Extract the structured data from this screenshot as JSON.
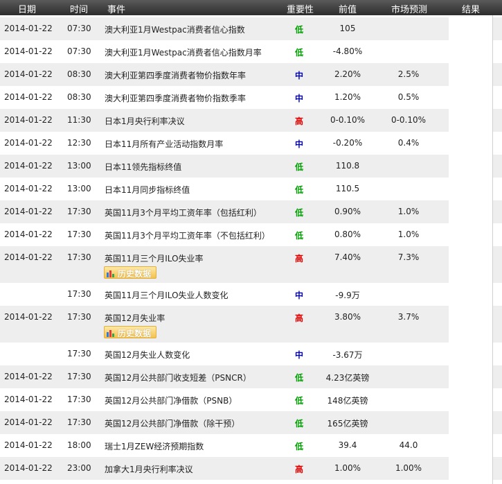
{
  "header": {
    "date": "日期",
    "time": "时间",
    "event": "事件",
    "importance": "重要性",
    "previous": "前值",
    "forecast": "市场预测",
    "result": "结果"
  },
  "history_label": "历史数据",
  "colors": {
    "header_bg": "#3c3c3c",
    "row_shade": "#eeeeee",
    "low": "#00a000",
    "medium": "#0000c0",
    "high": "#e00000",
    "button": "#f3c14f"
  },
  "rows": [
    {
      "date": "2014-01-22",
      "time": "07:30",
      "event": "澳大利亚1月Westpac消费者信心指数",
      "importance": "低",
      "level": "low",
      "previous": "105",
      "forecast": "",
      "result": "",
      "history": false
    },
    {
      "date": "2014-01-22",
      "time": "07:30",
      "event": "澳大利亚1月Westpac消费者信心指数月率",
      "importance": "低",
      "level": "low",
      "previous": "-4.80%",
      "forecast": "",
      "result": "",
      "history": false
    },
    {
      "date": "2014-01-22",
      "time": "08:30",
      "event": "澳大利亚第四季度消费者物价指数年率",
      "importance": "中",
      "level": "mid",
      "previous": "2.20%",
      "forecast": "2.5%",
      "result": "",
      "history": false
    },
    {
      "date": "2014-01-22",
      "time": "08:30",
      "event": "澳大利亚第四季度消费者物价指数季率",
      "importance": "中",
      "level": "mid",
      "previous": "1.20%",
      "forecast": "0.5%",
      "result": "",
      "history": false
    },
    {
      "date": "2014-01-22",
      "time": "11:30",
      "event": "日本1月央行利率决议",
      "importance": "高",
      "level": "high",
      "previous": "0-0.10%",
      "forecast": "0-0.10%",
      "result": "",
      "history": false
    },
    {
      "date": "2014-01-22",
      "time": "12:30",
      "event": "日本11月所有产业活动指数月率",
      "importance": "中",
      "level": "mid",
      "previous": "-0.20%",
      "forecast": "0.4%",
      "result": "",
      "history": false
    },
    {
      "date": "2014-01-22",
      "time": "13:00",
      "event": "日本11领先指标终值",
      "importance": "低",
      "level": "low",
      "previous": "110.8",
      "forecast": "",
      "result": "",
      "history": false
    },
    {
      "date": "2014-01-22",
      "time": "13:00",
      "event": "日本11月同步指标终值",
      "importance": "低",
      "level": "low",
      "previous": "110.5",
      "forecast": "",
      "result": "",
      "history": false
    },
    {
      "date": "2014-01-22",
      "time": "17:30",
      "event": "英国11月3个月平均工资年率（包括红利）",
      "importance": "低",
      "level": "low",
      "previous": "0.90%",
      "forecast": "1.0%",
      "result": "",
      "history": false
    },
    {
      "date": "2014-01-22",
      "time": "17:30",
      "event": "英国11月3个月平均工资年率（不包括红利）",
      "importance": "低",
      "level": "low",
      "previous": "0.80%",
      "forecast": "1.0%",
      "result": "",
      "history": false
    },
    {
      "date": "2014-01-22",
      "time": "17:30",
      "event": "英国11月三个月ILO失业率",
      "importance": "高",
      "level": "high",
      "previous": "7.40%",
      "forecast": "7.3%",
      "result": "",
      "history": true
    },
    {
      "date": "",
      "time": "17:30",
      "event": "英国11月三个月ILO失业人数变化",
      "importance": "中",
      "level": "mid",
      "previous": "-9.9万",
      "forecast": "",
      "result": "",
      "history": false
    },
    {
      "date": "2014-01-22",
      "time": "17:30",
      "event": "英国12月失业率",
      "importance": "高",
      "level": "high",
      "previous": "3.80%",
      "forecast": "3.7%",
      "result": "",
      "history": true
    },
    {
      "date": "",
      "time": "17:30",
      "event": "英国12月失业人数变化",
      "importance": "中",
      "level": "mid",
      "previous": "-3.67万",
      "forecast": "",
      "result": "",
      "history": false
    },
    {
      "date": "2014-01-22",
      "time": "17:30",
      "event": "英国12月公共部门收支短差（PSNCR）",
      "importance": "低",
      "level": "low",
      "previous": "4.23亿英镑",
      "forecast": "",
      "result": "",
      "history": false
    },
    {
      "date": "2014-01-22",
      "time": "17:30",
      "event": "英国12月公共部门净借款（PSNB）",
      "importance": "低",
      "level": "low",
      "previous": "148亿英镑",
      "forecast": "",
      "result": "",
      "history": false
    },
    {
      "date": "2014-01-22",
      "time": "17:30",
      "event": "英国12月公共部门净借款（除干预）",
      "importance": "低",
      "level": "low",
      "previous": "165亿英镑",
      "forecast": "",
      "result": "",
      "history": false
    },
    {
      "date": "2014-01-22",
      "time": "18:00",
      "event": "瑞士1月ZEW经济预期指数",
      "importance": "低",
      "level": "low",
      "previous": "39.4",
      "forecast": "44.0",
      "result": "",
      "history": false
    },
    {
      "date": "2014-01-22",
      "time": "23:00",
      "event": "加拿大1月央行利率决议",
      "importance": "高",
      "level": "high",
      "previous": "1.00%",
      "forecast": "1.00%",
      "result": "",
      "history": false
    }
  ]
}
